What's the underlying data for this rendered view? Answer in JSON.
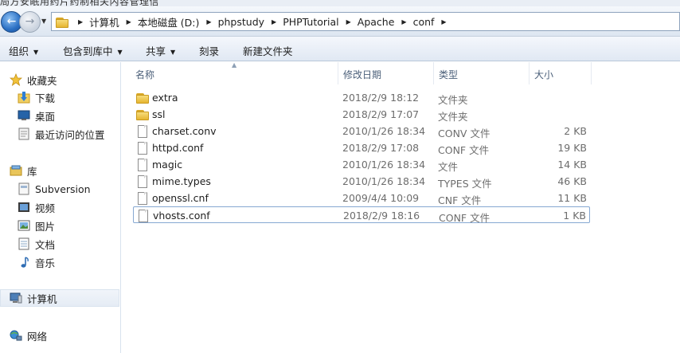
{
  "window": {
    "top_cut_text": "局方安眠用药片药制相关内容管理信"
  },
  "address_bar": {
    "crumbs": [
      "计算机",
      "本地磁盘 (D:)",
      "phpstudy",
      "PHPTutorial",
      "Apache",
      "conf"
    ]
  },
  "toolbar": {
    "organize": "组织",
    "include_in_library": "包含到库中",
    "share": "共享",
    "burn": "刻录",
    "new_folder": "新建文件夹"
  },
  "nav": {
    "favorites": "收藏夹",
    "downloads": "下载",
    "desktop": "桌面",
    "recent_places": "最近访问的位置",
    "libraries": "库",
    "subversion": "Subversion",
    "videos": "视频",
    "pictures": "图片",
    "documents": "文档",
    "music": "音乐",
    "computer": "计算机",
    "network": "网络"
  },
  "columns": {
    "name": "名称",
    "date": "修改日期",
    "type": "类型",
    "size": "大小"
  },
  "files": [
    {
      "name": "extra",
      "date": "2018/2/9 18:12",
      "type": "文件夹",
      "size": "",
      "icon": "folder-icon"
    },
    {
      "name": "ssl",
      "date": "2018/2/9 17:07",
      "type": "文件夹",
      "size": "",
      "icon": "folder-icon"
    },
    {
      "name": "charset.conv",
      "date": "2010/1/26 18:34",
      "type": "CONV 文件",
      "size": "2 KB",
      "icon": "file-icon"
    },
    {
      "name": "httpd.conf",
      "date": "2018/2/9 17:08",
      "type": "CONF 文件",
      "size": "19 KB",
      "icon": "file-icon"
    },
    {
      "name": "magic",
      "date": "2010/1/26 18:34",
      "type": "文件",
      "size": "14 KB",
      "icon": "file-icon"
    },
    {
      "name": "mime.types",
      "date": "2010/1/26 18:34",
      "type": "TYPES 文件",
      "size": "46 KB",
      "icon": "file-icon"
    },
    {
      "name": "openssl.cnf",
      "date": "2009/4/4 10:09",
      "type": "CNF 文件",
      "size": "11 KB",
      "icon": "file-icon"
    },
    {
      "name": "vhosts.conf",
      "date": "2018/2/9 18:16",
      "type": "CONF 文件",
      "size": "1 KB",
      "icon": "file-icon"
    }
  ],
  "focused_file": "vhosts.conf"
}
